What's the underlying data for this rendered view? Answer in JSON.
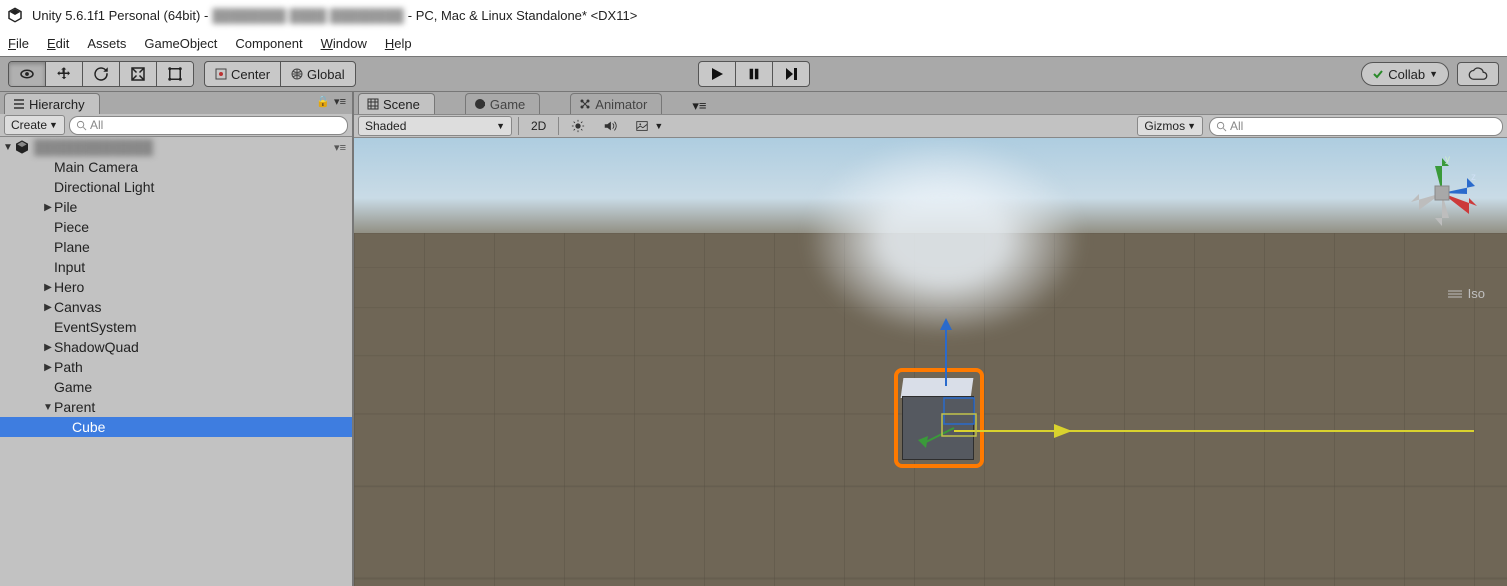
{
  "title": {
    "app": "Unity 5.6.1f1 Personal (64bit) -",
    "suffix": "- PC, Mac & Linux Standalone* <DX11>"
  },
  "menu": {
    "file": "File",
    "edit": "Edit",
    "assets": "Assets",
    "gameobject": "GameObject",
    "component": "Component",
    "window": "Window",
    "help": "Help"
  },
  "toolbar": {
    "center": "Center",
    "global": "Global",
    "collab": "Collab"
  },
  "hierarchy": {
    "tab": "Hierarchy",
    "create": "Create",
    "search_placeholder": "All",
    "items": [
      {
        "label": "Main Camera",
        "indent": 2,
        "arrow": ""
      },
      {
        "label": "Directional Light",
        "indent": 2,
        "arrow": ""
      },
      {
        "label": "Pile",
        "indent": 2,
        "arrow": "▶"
      },
      {
        "label": "Piece",
        "indent": 2,
        "arrow": ""
      },
      {
        "label": "Plane",
        "indent": 2,
        "arrow": ""
      },
      {
        "label": "Input",
        "indent": 2,
        "arrow": ""
      },
      {
        "label": "Hero",
        "indent": 2,
        "arrow": "▶"
      },
      {
        "label": "Canvas",
        "indent": 2,
        "arrow": "▶"
      },
      {
        "label": "EventSystem",
        "indent": 2,
        "arrow": ""
      },
      {
        "label": "ShadowQuad",
        "indent": 2,
        "arrow": "▶"
      },
      {
        "label": "Path",
        "indent": 2,
        "arrow": "▶"
      },
      {
        "label": "Game",
        "indent": 2,
        "arrow": ""
      },
      {
        "label": "Parent",
        "indent": 2,
        "arrow": "▼"
      },
      {
        "label": "Cube",
        "indent": 3,
        "arrow": "",
        "selected": true
      }
    ]
  },
  "scene": {
    "tabs": {
      "scene": "Scene",
      "game": "Game",
      "animator": "Animator"
    },
    "shading": "Shaded",
    "mode2d": "2D",
    "gizmos": "Gizmos",
    "search_placeholder": "All",
    "iso": "Iso",
    "axes": {
      "y": "y",
      "z": "z"
    }
  }
}
